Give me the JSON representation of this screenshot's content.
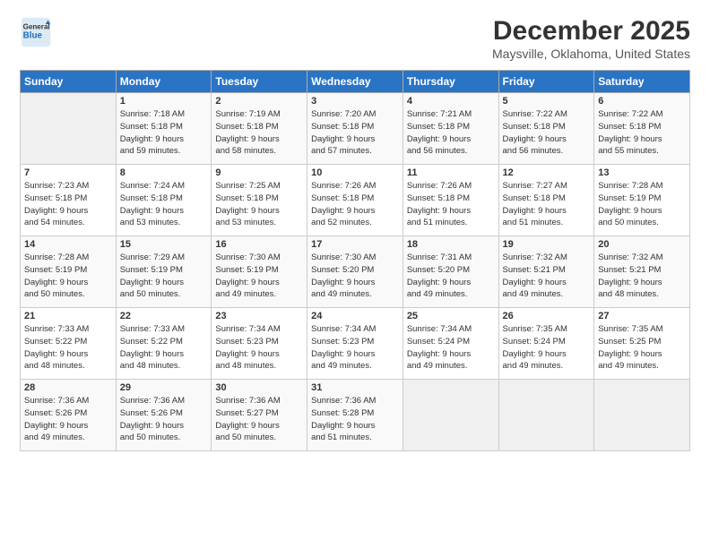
{
  "header": {
    "logo_line1": "General",
    "logo_line2": "Blue",
    "title": "December 2025",
    "subtitle": "Maysville, Oklahoma, United States"
  },
  "days_of_week": [
    "Sunday",
    "Monday",
    "Tuesday",
    "Wednesday",
    "Thursday",
    "Friday",
    "Saturday"
  ],
  "weeks": [
    [
      {
        "day": "",
        "content": ""
      },
      {
        "day": "1",
        "content": "Sunrise: 7:18 AM\nSunset: 5:18 PM\nDaylight: 9 hours\nand 59 minutes."
      },
      {
        "day": "2",
        "content": "Sunrise: 7:19 AM\nSunset: 5:18 PM\nDaylight: 9 hours\nand 58 minutes."
      },
      {
        "day": "3",
        "content": "Sunrise: 7:20 AM\nSunset: 5:18 PM\nDaylight: 9 hours\nand 57 minutes."
      },
      {
        "day": "4",
        "content": "Sunrise: 7:21 AM\nSunset: 5:18 PM\nDaylight: 9 hours\nand 56 minutes."
      },
      {
        "day": "5",
        "content": "Sunrise: 7:22 AM\nSunset: 5:18 PM\nDaylight: 9 hours\nand 56 minutes."
      },
      {
        "day": "6",
        "content": "Sunrise: 7:22 AM\nSunset: 5:18 PM\nDaylight: 9 hours\nand 55 minutes."
      }
    ],
    [
      {
        "day": "7",
        "content": "Sunrise: 7:23 AM\nSunset: 5:18 PM\nDaylight: 9 hours\nand 54 minutes."
      },
      {
        "day": "8",
        "content": "Sunrise: 7:24 AM\nSunset: 5:18 PM\nDaylight: 9 hours\nand 53 minutes."
      },
      {
        "day": "9",
        "content": "Sunrise: 7:25 AM\nSunset: 5:18 PM\nDaylight: 9 hours\nand 53 minutes."
      },
      {
        "day": "10",
        "content": "Sunrise: 7:26 AM\nSunset: 5:18 PM\nDaylight: 9 hours\nand 52 minutes."
      },
      {
        "day": "11",
        "content": "Sunrise: 7:26 AM\nSunset: 5:18 PM\nDaylight: 9 hours\nand 51 minutes."
      },
      {
        "day": "12",
        "content": "Sunrise: 7:27 AM\nSunset: 5:18 PM\nDaylight: 9 hours\nand 51 minutes."
      },
      {
        "day": "13",
        "content": "Sunrise: 7:28 AM\nSunset: 5:19 PM\nDaylight: 9 hours\nand 50 minutes."
      }
    ],
    [
      {
        "day": "14",
        "content": "Sunrise: 7:28 AM\nSunset: 5:19 PM\nDaylight: 9 hours\nand 50 minutes."
      },
      {
        "day": "15",
        "content": "Sunrise: 7:29 AM\nSunset: 5:19 PM\nDaylight: 9 hours\nand 50 minutes."
      },
      {
        "day": "16",
        "content": "Sunrise: 7:30 AM\nSunset: 5:19 PM\nDaylight: 9 hours\nand 49 minutes."
      },
      {
        "day": "17",
        "content": "Sunrise: 7:30 AM\nSunset: 5:20 PM\nDaylight: 9 hours\nand 49 minutes."
      },
      {
        "day": "18",
        "content": "Sunrise: 7:31 AM\nSunset: 5:20 PM\nDaylight: 9 hours\nand 49 minutes."
      },
      {
        "day": "19",
        "content": "Sunrise: 7:32 AM\nSunset: 5:21 PM\nDaylight: 9 hours\nand 49 minutes."
      },
      {
        "day": "20",
        "content": "Sunrise: 7:32 AM\nSunset: 5:21 PM\nDaylight: 9 hours\nand 48 minutes."
      }
    ],
    [
      {
        "day": "21",
        "content": "Sunrise: 7:33 AM\nSunset: 5:22 PM\nDaylight: 9 hours\nand 48 minutes."
      },
      {
        "day": "22",
        "content": "Sunrise: 7:33 AM\nSunset: 5:22 PM\nDaylight: 9 hours\nand 48 minutes."
      },
      {
        "day": "23",
        "content": "Sunrise: 7:34 AM\nSunset: 5:23 PM\nDaylight: 9 hours\nand 48 minutes."
      },
      {
        "day": "24",
        "content": "Sunrise: 7:34 AM\nSunset: 5:23 PM\nDaylight: 9 hours\nand 49 minutes."
      },
      {
        "day": "25",
        "content": "Sunrise: 7:34 AM\nSunset: 5:24 PM\nDaylight: 9 hours\nand 49 minutes."
      },
      {
        "day": "26",
        "content": "Sunrise: 7:35 AM\nSunset: 5:24 PM\nDaylight: 9 hours\nand 49 minutes."
      },
      {
        "day": "27",
        "content": "Sunrise: 7:35 AM\nSunset: 5:25 PM\nDaylight: 9 hours\nand 49 minutes."
      }
    ],
    [
      {
        "day": "28",
        "content": "Sunrise: 7:36 AM\nSunset: 5:26 PM\nDaylight: 9 hours\nand 49 minutes."
      },
      {
        "day": "29",
        "content": "Sunrise: 7:36 AM\nSunset: 5:26 PM\nDaylight: 9 hours\nand 50 minutes."
      },
      {
        "day": "30",
        "content": "Sunrise: 7:36 AM\nSunset: 5:27 PM\nDaylight: 9 hours\nand 50 minutes."
      },
      {
        "day": "31",
        "content": "Sunrise: 7:36 AM\nSunset: 5:28 PM\nDaylight: 9 hours\nand 51 minutes."
      },
      {
        "day": "",
        "content": ""
      },
      {
        "day": "",
        "content": ""
      },
      {
        "day": "",
        "content": ""
      }
    ]
  ]
}
